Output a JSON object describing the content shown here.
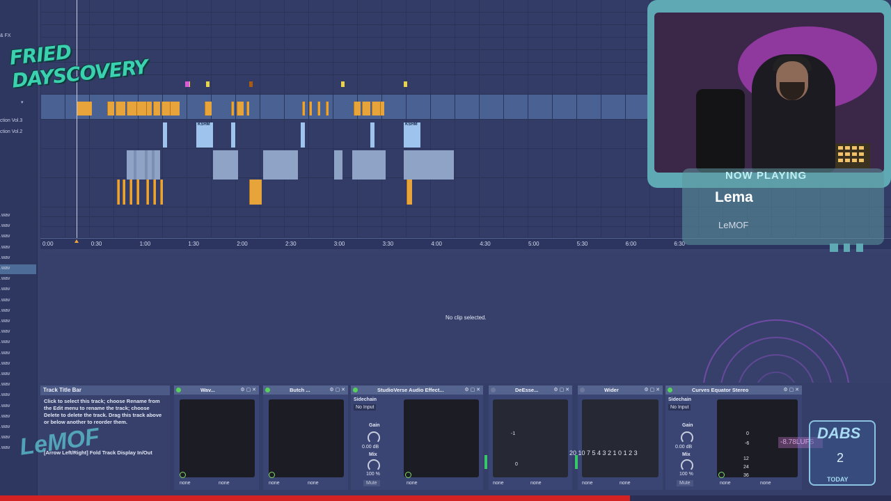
{
  "browser": {
    "header": "& FX",
    "items": [
      {
        "label": "ction Vol.3"
      },
      {
        "label": "ction Vol.2"
      },
      {
        "label": ".wav"
      },
      {
        "label": ".wav"
      },
      {
        "label": ".wav"
      },
      {
        "label": ".wav"
      },
      {
        "label": ".wav"
      },
      {
        "label": ".wav"
      },
      {
        "label": ".wav"
      },
      {
        "label": ".wav"
      },
      {
        "label": ".wav"
      },
      {
        "label": ".wav"
      },
      {
        "label": ".wav"
      },
      {
        "label": ".wav"
      },
      {
        "label": ".wav"
      },
      {
        "label": ".wav"
      },
      {
        "label": ".wav"
      },
      {
        "label": ".wav"
      },
      {
        "label": ".wav"
      },
      {
        "label": ".wav"
      },
      {
        "label": ".wav"
      },
      {
        "label": ".wav"
      },
      {
        "label": ".wav"
      },
      {
        "label": ".wav"
      },
      {
        "label": ".wav"
      }
    ]
  },
  "logo": {
    "text": "FRIED DAYSCOVERY"
  },
  "timeline": {
    "ticks": [
      "0:00",
      "0:30",
      "1:00",
      "1:30",
      "2:00",
      "2:30",
      "3:00",
      "3:30",
      "4:00",
      "4:30",
      "5:00",
      "5:30",
      "6:00",
      "6:30"
    ],
    "clip_labels": {
      "kshm1": "KSHM",
      "kshm2": "KSHM"
    }
  },
  "now_playing": {
    "heading": "NOW PLAYING",
    "song": "Lema",
    "artist": "LeMOF"
  },
  "detail": {
    "empty_message": "No clip selected."
  },
  "info_panel": {
    "title": "Track Title Bar",
    "body": "Click to select this track; choose Rename from the Edit menu to rename the track; choose Delete to delete the track. Drag this track above or below another to reorder them.",
    "hint": "[Arrow Left/Right] Fold Track Display In/Out"
  },
  "devices": [
    {
      "name": "Wav...",
      "foot_a": "none",
      "foot_b": "none",
      "on": true
    },
    {
      "name": "Butch ...",
      "foot_a": "none",
      "foot_b": "none",
      "on": true
    },
    {
      "name": "StudioVerse Audio Effect...",
      "foot_a": "none",
      "foot_b": "none",
      "on": true,
      "sidechain": "Sidechain",
      "input": "No Input",
      "gain": "Gain",
      "gain_val": "0.00 dB",
      "mix": "Mix",
      "mix_val": "100 %",
      "mute": "Mute"
    },
    {
      "name": "DeEsse...",
      "foot_a": "none",
      "foot_b": "none",
      "on": false,
      "scale_a": "-1",
      "scale_b": "0"
    },
    {
      "name": "Wider",
      "foot_a": "none",
      "foot_b": "none",
      "on": false,
      "vu_scale": "20 10 7 5 4 3 2 1 0 1 2 3"
    },
    {
      "name": "Curves Equator Stereo",
      "foot_a": "none",
      "foot_b": "none",
      "on": true,
      "sidechain": "Sidechain",
      "input": "No Input",
      "gain": "Gain",
      "gain_val": "0.00 dB",
      "mix": "Mix",
      "mix_val": "100 %",
      "mute": "Mute",
      "scale": [
        "0",
        "-6",
        "12",
        "24",
        "36"
      ]
    }
  ],
  "overlay": {
    "lufs": "-8.78LUFS",
    "dabs_title": "DABS",
    "dabs_count": "2",
    "dabs_sub": "TODAY",
    "watermark": "LeMOF"
  },
  "colors": {
    "accent_orange": "#e7a43a",
    "selection_blue": "#4a6193",
    "device_on": "#56d15a",
    "status_red": "#d42222"
  }
}
